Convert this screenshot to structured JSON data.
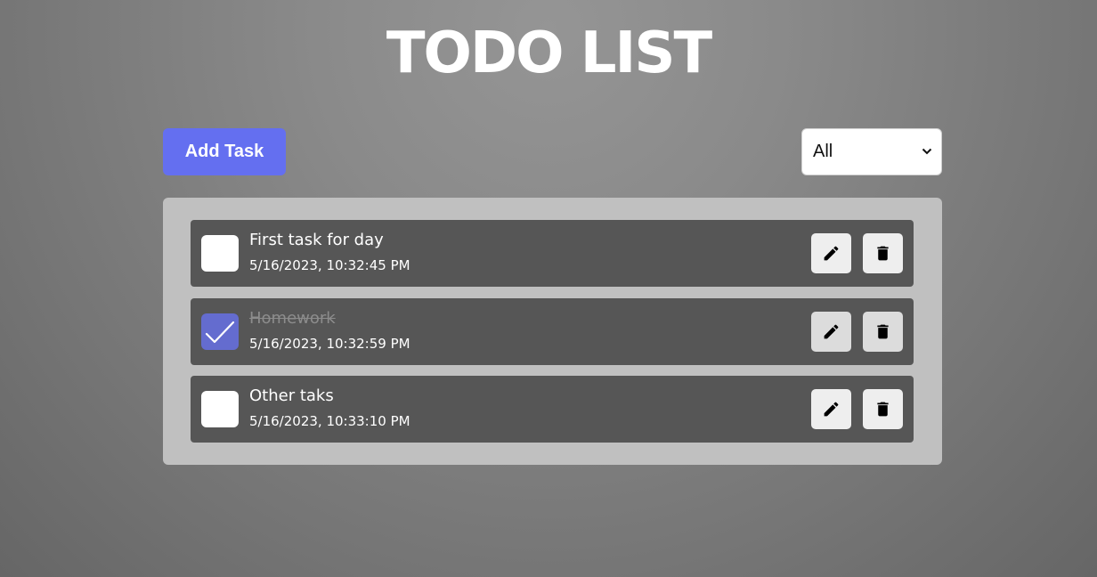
{
  "header": {
    "title": "TODO LIST"
  },
  "toolbar": {
    "add_label": "Add Task",
    "filter_value": "All"
  },
  "colors": {
    "accent": "#646ff0",
    "checked": "#646ccf",
    "item_bg": "#565656",
    "panel_bg": "#c0c0c0"
  },
  "todos": [
    {
      "title": "First task for day",
      "time": "5/16/2023, 10:32:45 PM",
      "completed": false,
      "edit_icon": "pencil-icon",
      "delete_icon": "trash-icon"
    },
    {
      "title": "Homework",
      "time": "5/16/2023, 10:32:59 PM",
      "completed": true,
      "edit_icon": "pencil-icon",
      "delete_icon": "trash-icon"
    },
    {
      "title": "Other taks",
      "time": "5/16/2023, 10:33:10 PM",
      "completed": false,
      "edit_icon": "pencil-icon",
      "delete_icon": "trash-icon"
    }
  ]
}
